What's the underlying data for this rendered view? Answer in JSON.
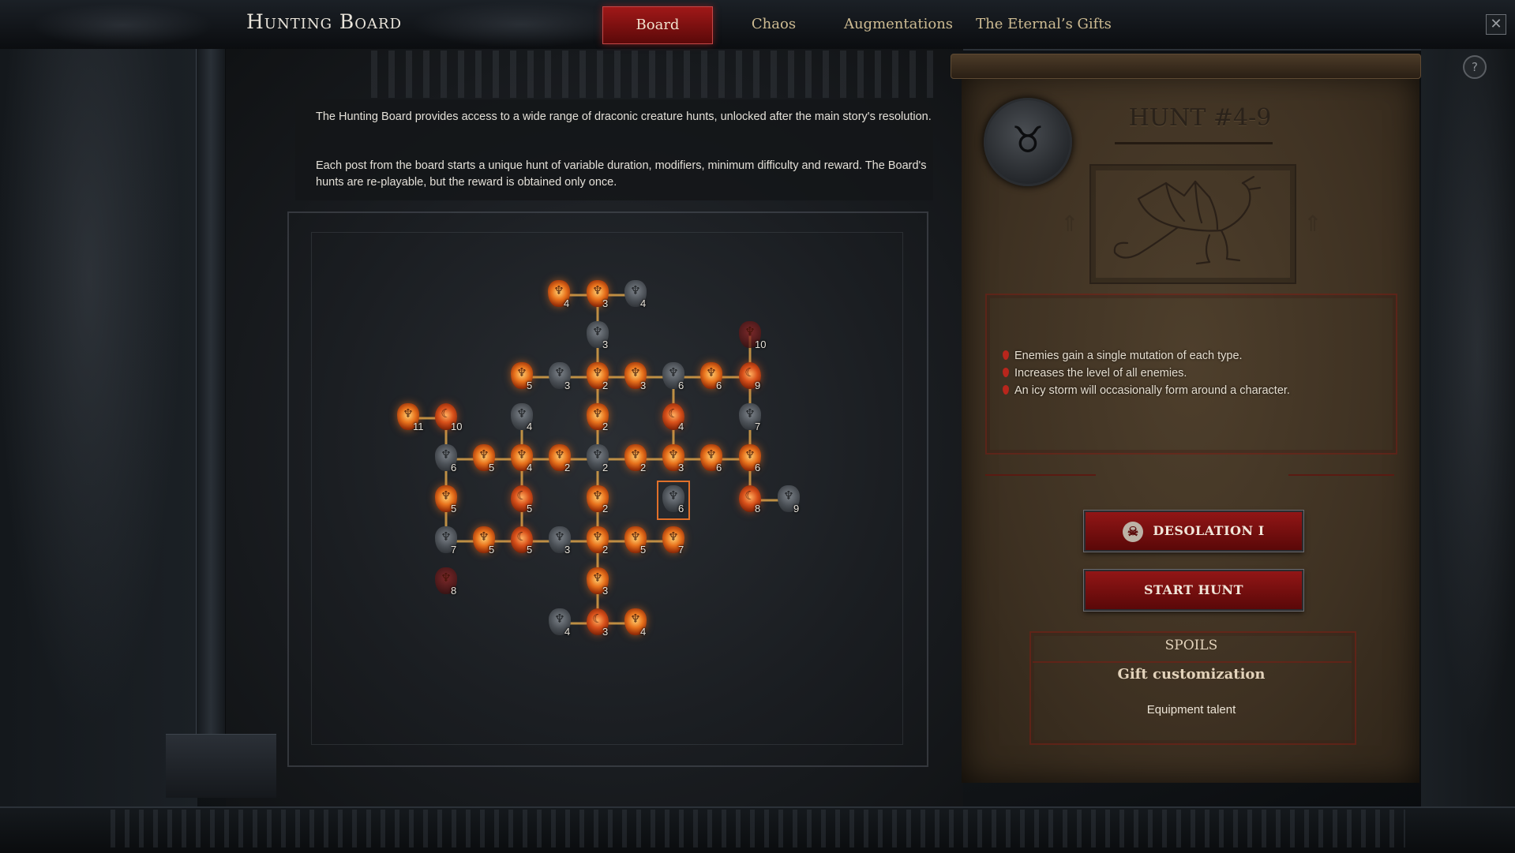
{
  "window": {
    "title": "Hunting Board",
    "close_glyph": "✕",
    "help_glyph": "?"
  },
  "tabs": [
    {
      "label": "Board",
      "active": true
    },
    {
      "label": "Chaos",
      "active": false
    },
    {
      "label": "Augmentations",
      "active": false
    },
    {
      "label": "The Eternal’s Gifts",
      "active": false
    }
  ],
  "description": {
    "line1": "The Hunting Board provides access to a wide range of draconic creature hunts, unlocked after the main story's resolution.",
    "line2": "Each post from the board starts a unique hunt of variable duration, modifiers, minimum difficulty and reward. The Board's hunts are re-playable, but the reward is obtained only once."
  },
  "board": {
    "icon_types": {
      "fire": "demon-head-icon",
      "crescent": "crescent-icon",
      "dark": "locked-demon-icon",
      "red": "blood-demon-icon"
    },
    "nodes": [
      {
        "id": "n1",
        "type": "fire",
        "num": "4"
      },
      {
        "id": "n2",
        "type": "fire",
        "num": "3"
      },
      {
        "id": "n3",
        "type": "dark",
        "num": "4"
      },
      {
        "id": "n4",
        "type": "dark",
        "num": "3"
      },
      {
        "id": "n5",
        "type": "red",
        "num": "10"
      },
      {
        "id": "n6",
        "type": "fire",
        "num": "5"
      },
      {
        "id": "n7",
        "type": "dark",
        "num": "3"
      },
      {
        "id": "n8",
        "type": "fire",
        "num": "2"
      },
      {
        "id": "n9",
        "type": "fire",
        "num": "3"
      },
      {
        "id": "n10",
        "type": "dark",
        "num": "6"
      },
      {
        "id": "n11",
        "type": "fire",
        "num": "6"
      },
      {
        "id": "n12",
        "type": "crescent",
        "num": "9"
      },
      {
        "id": "n13",
        "type": "fire",
        "num": "11"
      },
      {
        "id": "n14",
        "type": "crescent",
        "num": "10"
      },
      {
        "id": "n15",
        "type": "dark",
        "num": "4"
      },
      {
        "id": "n16",
        "type": "fire",
        "num": "2"
      },
      {
        "id": "n17",
        "type": "crescent",
        "num": "4"
      },
      {
        "id": "n18",
        "type": "dark",
        "num": "7"
      },
      {
        "id": "n19",
        "type": "dark",
        "num": "6"
      },
      {
        "id": "n20",
        "type": "fire",
        "num": "5"
      },
      {
        "id": "n21",
        "type": "fire",
        "num": "4"
      },
      {
        "id": "n22",
        "type": "fire",
        "num": "2"
      },
      {
        "id": "n23",
        "type": "dark",
        "num": "2"
      },
      {
        "id": "n24",
        "type": "fire",
        "num": "2"
      },
      {
        "id": "n25",
        "type": "fire",
        "num": "3"
      },
      {
        "id": "n26",
        "type": "fire",
        "num": "6"
      },
      {
        "id": "n27",
        "type": "fire",
        "num": "6"
      },
      {
        "id": "n28",
        "type": "fire",
        "num": "5"
      },
      {
        "id": "n29",
        "type": "crescent",
        "num": "5"
      },
      {
        "id": "n30",
        "type": "fire",
        "num": "2"
      },
      {
        "id": "n31",
        "type": "dark",
        "num": "6",
        "selected": true
      },
      {
        "id": "n32",
        "type": "crescent",
        "num": "8"
      },
      {
        "id": "n33",
        "type": "dark",
        "num": "9"
      },
      {
        "id": "n34",
        "type": "dark",
        "num": "7"
      },
      {
        "id": "n35",
        "type": "fire",
        "num": "5"
      },
      {
        "id": "n36",
        "type": "crescent",
        "num": "5"
      },
      {
        "id": "n37",
        "type": "dark",
        "num": "3"
      },
      {
        "id": "n38",
        "type": "fire",
        "num": "2"
      },
      {
        "id": "n39",
        "type": "fire",
        "num": "5"
      },
      {
        "id": "n40",
        "type": "fire",
        "num": "7"
      },
      {
        "id": "n41",
        "type": "red",
        "num": "8"
      },
      {
        "id": "n42",
        "type": "fire",
        "num": "3"
      },
      {
        "id": "n43",
        "type": "dark",
        "num": "4"
      },
      {
        "id": "n44",
        "type": "crescent",
        "num": "3"
      },
      {
        "id": "n45",
        "type": "fire",
        "num": "4"
      }
    ],
    "links": [
      [
        "n1",
        "n2"
      ],
      [
        "n2",
        "n3"
      ],
      [
        "n2",
        "n4"
      ],
      [
        "n4",
        "n8"
      ],
      [
        "n6",
        "n7"
      ],
      [
        "n7",
        "n8"
      ],
      [
        "n8",
        "n9"
      ],
      [
        "n9",
        "n10"
      ],
      [
        "n10",
        "n11"
      ],
      [
        "n11",
        "n12"
      ],
      [
        "n5",
        "n12"
      ],
      [
        "n8",
        "n16"
      ],
      [
        "n10",
        "n17"
      ],
      [
        "n12",
        "n18"
      ],
      [
        "n13",
        "n14"
      ],
      [
        "n15",
        "n21"
      ],
      [
        "n16",
        "n23"
      ],
      [
        "n17",
        "n25"
      ],
      [
        "n18",
        "n27"
      ],
      [
        "n19",
        "n20"
      ],
      [
        "n20",
        "n21"
      ],
      [
        "n21",
        "n22"
      ],
      [
        "n22",
        "n23"
      ],
      [
        "n23",
        "n24"
      ],
      [
        "n24",
        "n25"
      ],
      [
        "n25",
        "n26"
      ],
      [
        "n26",
        "n27"
      ],
      [
        "n14",
        "n19"
      ],
      [
        "n19",
        "n28"
      ],
      [
        "n21",
        "n29"
      ],
      [
        "n23",
        "n30"
      ],
      [
        "n28",
        "n34"
      ],
      [
        "n29",
        "n36"
      ],
      [
        "n30",
        "n38"
      ],
      [
        "n32",
        "n33"
      ],
      [
        "n27",
        "n32"
      ],
      [
        "n34",
        "n35"
      ],
      [
        "n35",
        "n36"
      ],
      [
        "n36",
        "n37"
      ],
      [
        "n37",
        "n38"
      ],
      [
        "n38",
        "n39"
      ],
      [
        "n39",
        "n40"
      ],
      [
        "n38",
        "n42"
      ],
      [
        "n42",
        "n44"
      ],
      [
        "n43",
        "n44"
      ],
      [
        "n44",
        "n45"
      ]
    ]
  },
  "hunt": {
    "emblem_icon": "horned-demon-emblem-icon",
    "emblem_glyph": "♉",
    "title": "HUNT #4-9",
    "creature_icon": "dragon-creature-icon",
    "rune_icon": "rune-arrow-icon",
    "rune_glyph": "⇑",
    "modifiers": [
      "Enemies gain a single mutation of each type.",
      "Increases the level of all enemies.",
      "An icy storm will occasionally form around a character."
    ],
    "difficulty_label": "DESOLATION I",
    "difficulty_glyph": "☠",
    "start_label": "START HUNT",
    "spoils": {
      "title": "SPOILS",
      "item": "Gift customization",
      "sub": "Equipment talent"
    }
  }
}
